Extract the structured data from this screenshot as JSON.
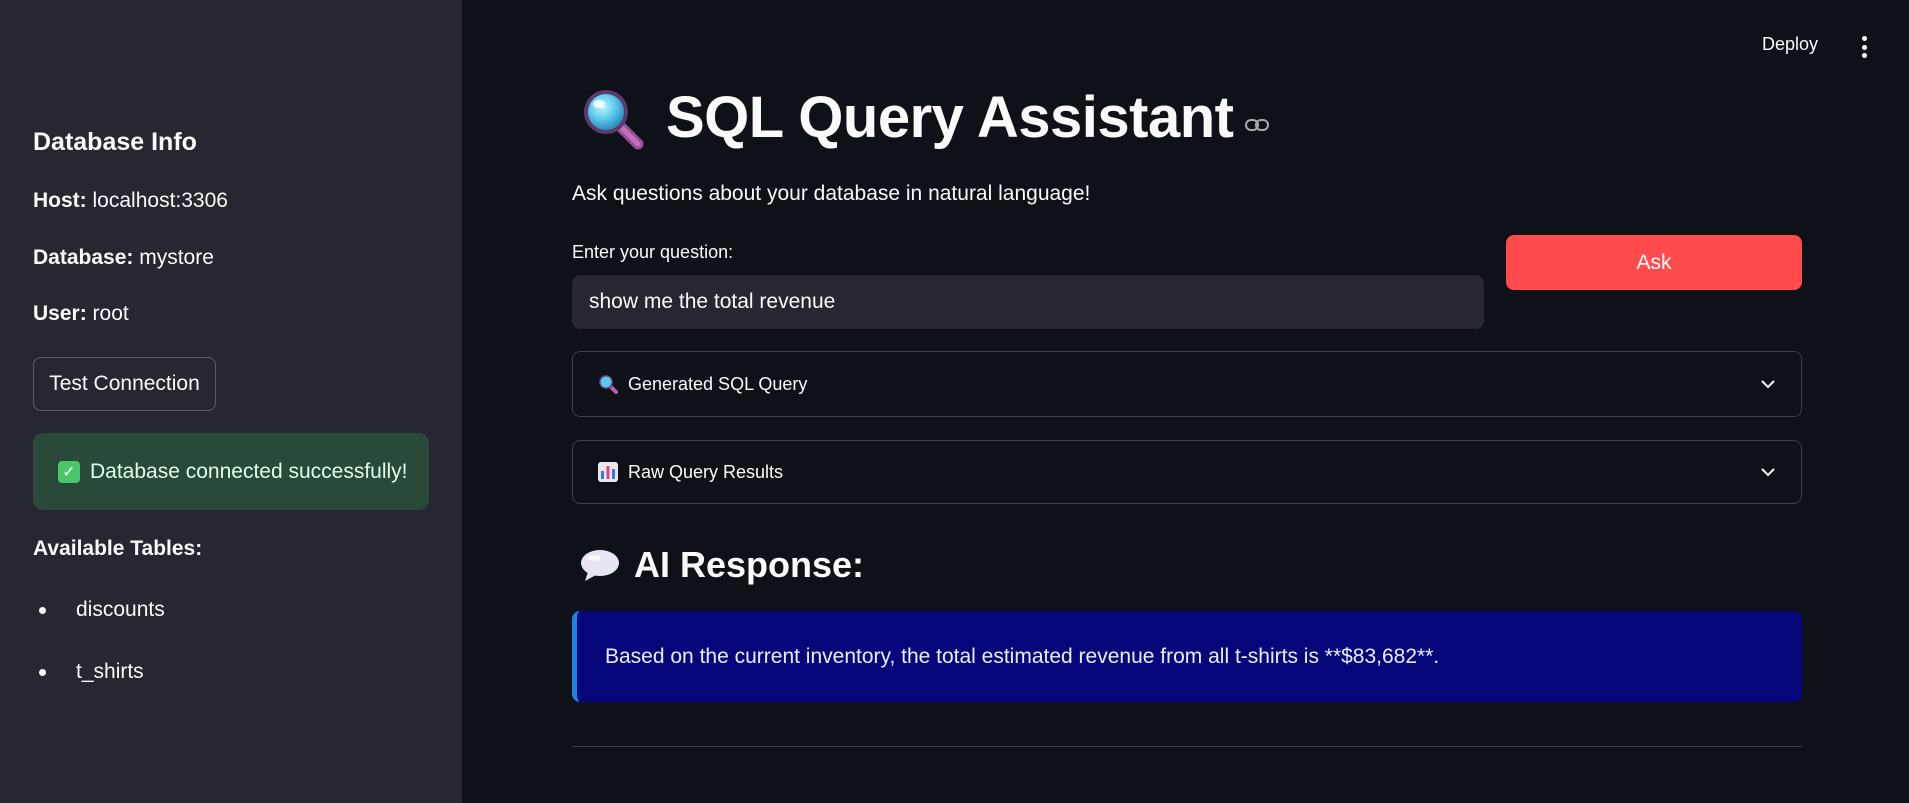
{
  "header": {
    "deploy_label": "Deploy",
    "menu_icon": "vertical-ellipsis-icon"
  },
  "sidebar": {
    "title": "Database Info",
    "host_label": "Host:",
    "host_value": "localhost:3306",
    "database_label": "Database:",
    "database_value": "mystore",
    "user_label": "User:",
    "user_value": "root",
    "test_button_label": "Test Connection",
    "status_message": "Database connected successfully!",
    "status_icon": "check-icon",
    "tables_title": "Available Tables:",
    "tables": [
      "discounts",
      "t_shirts"
    ]
  },
  "main": {
    "title": "SQL Query Assistant",
    "title_icon": "magnifying-glass-icon",
    "subtitle": "Ask questions about your database in natural language!",
    "input_label": "Enter your question:",
    "input_value": "show me the total revenue",
    "ask_label": "Ask",
    "expanders": [
      {
        "label": "Generated SQL Query",
        "icon": "magnifying-glass-icon"
      },
      {
        "label": "Raw Query Results",
        "icon": "bar-chart-icon"
      }
    ],
    "ai_title": "AI Response:",
    "ai_icon": "speech-bubble-icon",
    "ai_response": "Based on the current inventory, the total estimated revenue from all t-shirts is **$83,682**."
  },
  "colors": {
    "background": "#0e1117",
    "sidebar": "#262730",
    "accent": "#ff4b4b",
    "success_bg": "#294939",
    "info_bg": "#06067b",
    "info_border": "#1c83e1"
  }
}
